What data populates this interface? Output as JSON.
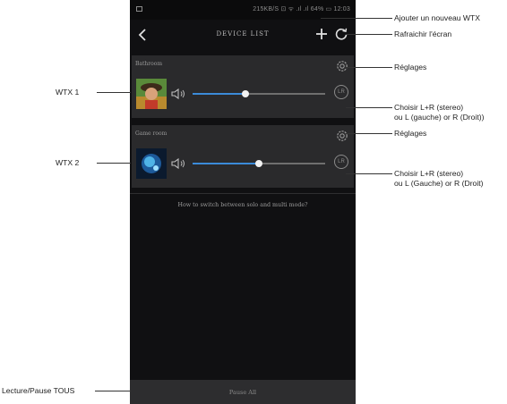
{
  "status_bar": {
    "info": "215KB/S ⊡ ᯤ .ıl .ıl 64% ▭ 12:03"
  },
  "header": {
    "title": "DEVICE LIST"
  },
  "devices": [
    {
      "name": "Bathroom",
      "volume_percent": 40
    },
    {
      "name": "Game room",
      "volume_percent": 50
    }
  ],
  "lr_label": "LR",
  "help_link": "How to switch between solo and multi mode?",
  "bottom_bar": {
    "label": "Pause All"
  },
  "annotations": {
    "add_wtx": "Ajouter un nouveau WTX",
    "refresh": "Rafraichir l'écran",
    "settings_1": "Réglages",
    "settings_2": "Réglages",
    "wtx1": "WTX 1",
    "wtx2": "WTX 2",
    "lr1_line1": "Choisir L+R (stereo)",
    "lr1_line2": "ou L (gauche) or R (Droit))",
    "lr2_line1": "Choisir L+R (stereo)",
    "lr2_line2": "ou L (Gauche) or R (Droit)",
    "play_pause_all": "Lecture/Pause TOUS"
  },
  "colors": {
    "accent": "#3b8bd9",
    "background": "#101012",
    "card": "#2a2a2c"
  },
  "icons": [
    "back-icon",
    "plus-icon",
    "refresh-icon",
    "gear-icon",
    "speaker-icon",
    "lr-icon"
  ]
}
